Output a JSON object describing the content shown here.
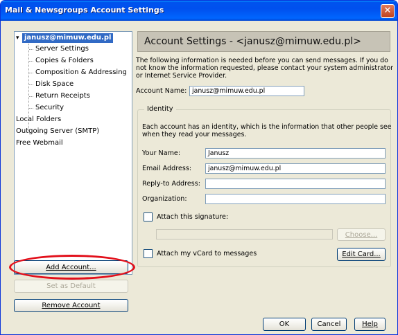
{
  "window": {
    "title": "Mail & Newsgroups Account Settings",
    "close_glyph": "✕"
  },
  "tree": {
    "account": "janusz@mimuw.edu.pl",
    "expander": "▾",
    "children": [
      "Server Settings",
      "Copies & Folders",
      "Composition & Addressing",
      "Disk Space",
      "Return Receipts",
      "Security"
    ],
    "top_items": [
      "Local Folders",
      "Outgoing Server (SMTP)",
      "Free Webmail"
    ]
  },
  "buttons": {
    "add_account": "Add Account...",
    "set_default": "Set as Default",
    "remove_account": "Remove Account",
    "choose": "Choose...",
    "edit_card": "Edit Card...",
    "ok": "OK",
    "cancel": "Cancel",
    "help": "Help"
  },
  "panel": {
    "header": "Account Settings - <janusz@mimuw.edu.pl>",
    "intro_lines": [
      "The following information is needed before you can send messages. If you do",
      "not know the information requested, please contact your system administrator",
      "or Internet Service Provider."
    ],
    "account_name_label": "Account Name:",
    "account_name_value": "janusz@mimuw.edu.pl"
  },
  "identity": {
    "legend": "Identity",
    "desc_lines": [
      "Each account has an identity, which is the information that other people see",
      "when they read your messages."
    ],
    "your_name_label": "Your Name:",
    "your_name_value": "Janusz",
    "email_label": "Email Address:",
    "email_value": "janusz@mimuw.edu.pl",
    "reply_to_label": "Reply-to Address:",
    "reply_to_value": "",
    "organization_label": "Organization:",
    "organization_value": "",
    "attach_signature_label": "Attach this signature:",
    "attach_signature_checked": false,
    "signature_path": "",
    "attach_vcard_label": "Attach my vCard to messages",
    "attach_vcard_checked": false
  }
}
